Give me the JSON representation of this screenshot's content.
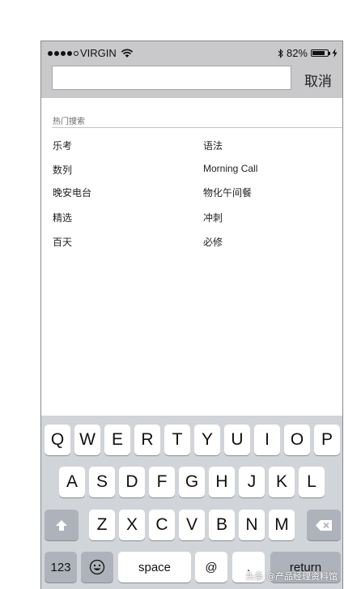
{
  "status": {
    "carrier": "VIRGIN",
    "battery_percent": "82%",
    "signal_bars": 4,
    "battery_level": 0.82
  },
  "search": {
    "value": "",
    "placeholder": "",
    "cancel_label": "取消"
  },
  "hot": {
    "title": "热门搜索",
    "left": [
      "乐考",
      "数列",
      "晚安电台",
      "精选",
      "百天"
    ],
    "right": [
      "语法",
      "Morning Call",
      "物化午间餐",
      "冲刺",
      "必修"
    ]
  },
  "keyboard": {
    "row1": [
      "Q",
      "W",
      "E",
      "R",
      "T",
      "Y",
      "U",
      "I",
      "O",
      "P"
    ],
    "row2": [
      "A",
      "S",
      "D",
      "F",
      "G",
      "H",
      "J",
      "K",
      "L"
    ],
    "row3": [
      "Z",
      "X",
      "C",
      "V",
      "B",
      "N",
      "M"
    ],
    "numbers_label": "123",
    "space_label": "space",
    "at_label": "@",
    "period_label": ".",
    "return_label": "return",
    "icons": {
      "shift": "shift-arrow-icon",
      "delete": "backspace-icon",
      "emoji": "emoji-icon"
    }
  },
  "watermark": "头条 @产品经理资料馆"
}
